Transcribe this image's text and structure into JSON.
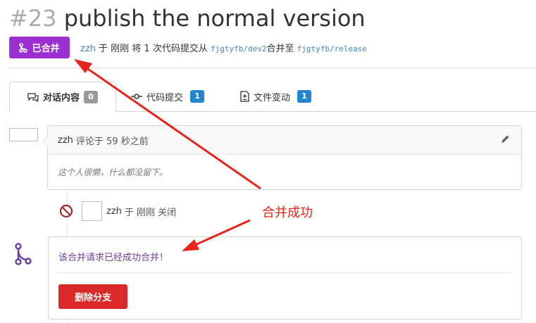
{
  "pr": {
    "number": "#23",
    "title": "publish the normal version",
    "status_label": "已合并",
    "author": "zzh",
    "summary_pre": " 于 刚刚 将 1 次代码提交从 ",
    "from_branch": "fjgtyfb/dev2",
    "summary_mid": "合并至 ",
    "to_branch": "fjgtyfb/release"
  },
  "tabs": [
    {
      "label": "对话内容",
      "count": "0",
      "icon": "comments-icon"
    },
    {
      "label": "代码提交",
      "count": "1",
      "icon": "commit-icon"
    },
    {
      "label": "文件变动",
      "count": "1",
      "icon": "file-diff-icon"
    }
  ],
  "comment": {
    "author": "zzh",
    "meta": "评论于 59 秒之前",
    "body": "这个人很懒，什么都没留下。"
  },
  "event": {
    "user": "zzh",
    "text": "于 刚刚 关闭"
  },
  "merge": {
    "message": "该合并请求已经成功合并！",
    "delete_label": "删除分支"
  },
  "annotation": {
    "label": "合并成功"
  },
  "colors": {
    "merged": "#9b2fd1",
    "delete": "#db2828",
    "link": "#4183c4",
    "annotation": "#e8231a"
  }
}
